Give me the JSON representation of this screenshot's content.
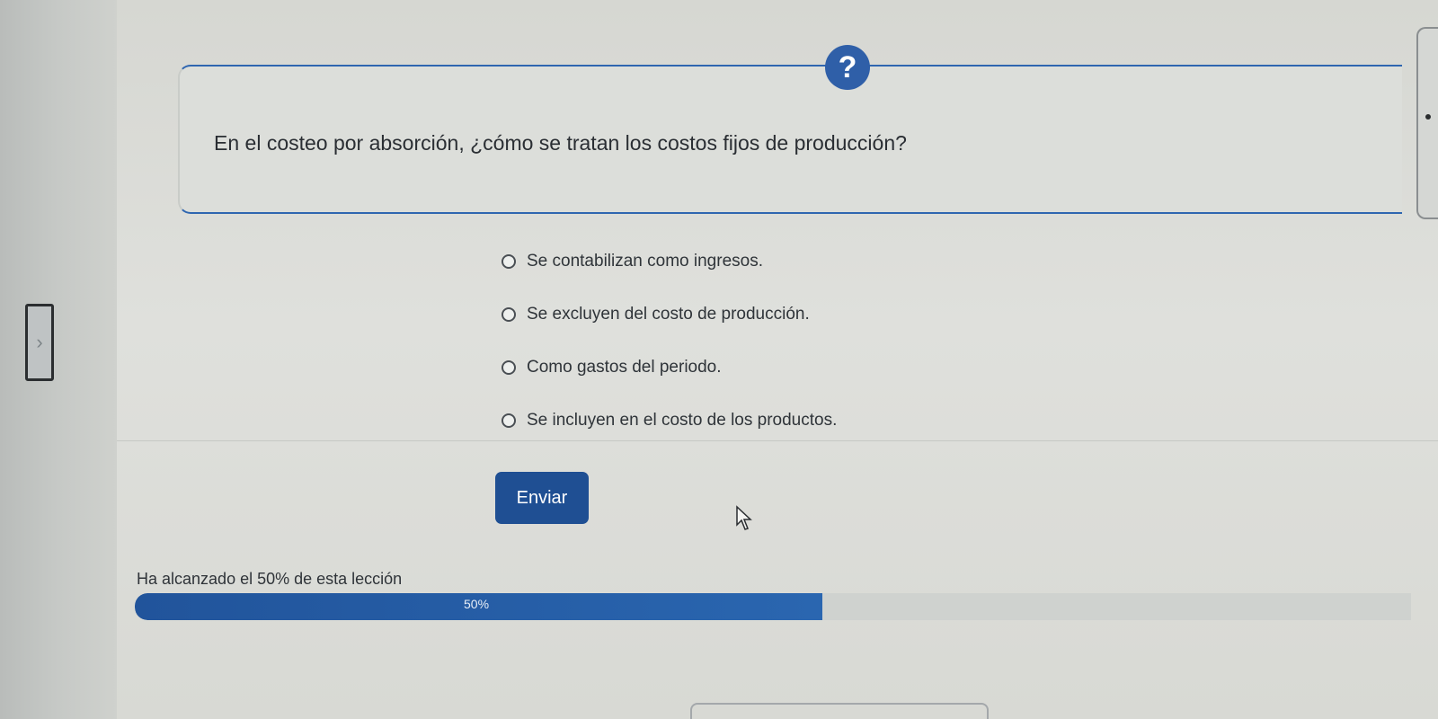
{
  "question": {
    "icon": "question-mark-icon",
    "icon_glyph": "?",
    "text": "En el costeo por absorción, ¿cómo se tratan los costos fijos de producción?"
  },
  "options": [
    {
      "label": "Se contabilizan como ingresos.",
      "selected": false
    },
    {
      "label": "Se excluyen del costo de producción.",
      "selected": false
    },
    {
      "label": "Como gastos del periodo.",
      "selected": false
    },
    {
      "label": "Se incluyen en el costo de los productos.",
      "selected": false
    }
  ],
  "submit": {
    "label": "Enviar"
  },
  "progress": {
    "text": "Ha alcanzado el 50% de esta lección",
    "value_label": "50%",
    "percent": 50
  },
  "nav": {
    "toggle_glyph": "›"
  },
  "colors": {
    "accent": "#1f4f93",
    "progress_fill": "#2a66b0",
    "card_border": "#2f66b0"
  }
}
